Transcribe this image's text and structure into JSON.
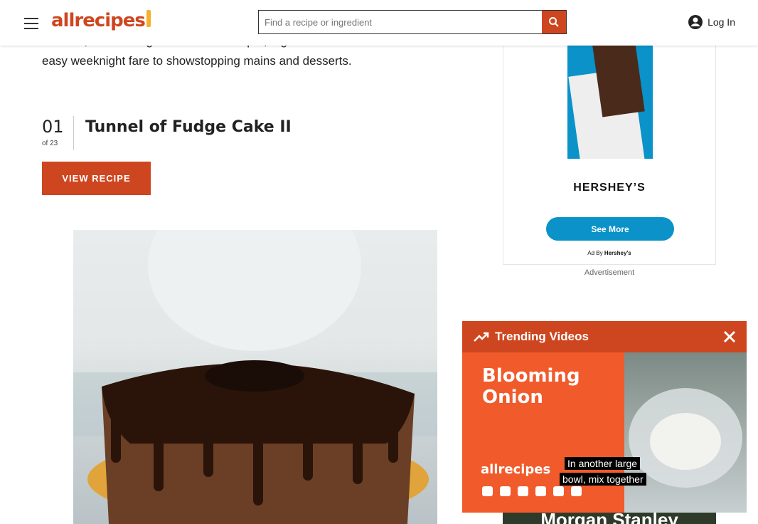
{
  "header": {
    "logo": "allrecipes",
    "search_placeholder": "Find a recipe or ingredient",
    "login_label": "Log In"
  },
  "intro": {
    "line1": "ultimate, chocolate glazed ... hits the spot, e.g.",
    "line2": "easy weeknight fare to showstopping mains and desserts."
  },
  "item": {
    "number": "01",
    "of": "of 23",
    "title": "Tunnel of Fudge Cake II",
    "button": "VIEW RECIPE"
  },
  "ad": {
    "brand": "HERSHEY’S",
    "cta": "See More",
    "by_prefix": "Ad By",
    "by_brand": "Hershey's",
    "label": "Advertisement"
  },
  "trending": {
    "title": "Trending Videos",
    "video_title_line1": "Blooming",
    "video_title_line2": "Onion",
    "caption_line1": "In another large",
    "caption_line2": "bowl, mix together",
    "video_logo": "allrecipes"
  },
  "bottom_ad": {
    "text": "Morgan Stanley"
  },
  "colors": {
    "brand": "#ce4620",
    "accent": "#f6b02e",
    "ad_blue": "#0a92c9"
  }
}
